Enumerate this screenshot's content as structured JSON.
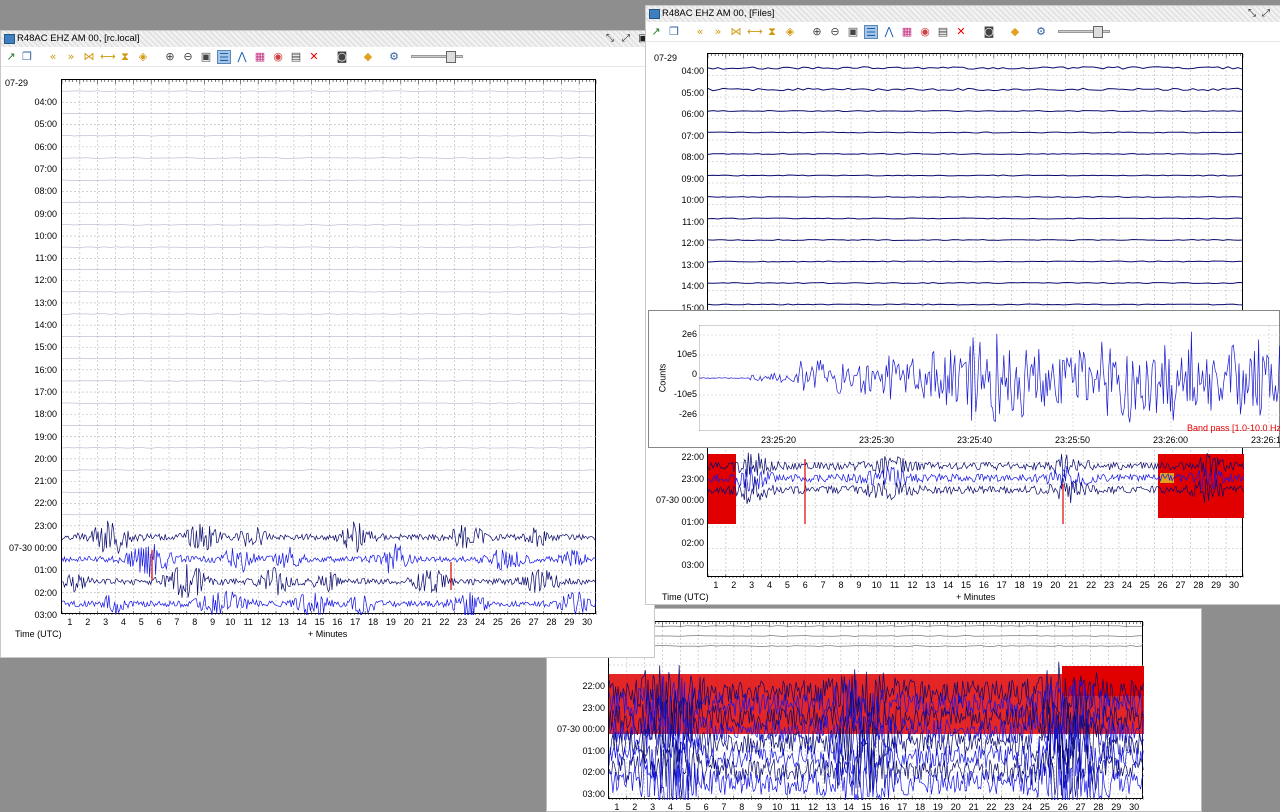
{
  "left_window": {
    "title": "R48AC EHZ AM 00, [rc.local]",
    "date_label": "07-29",
    "hours": [
      "04:00",
      "05:00",
      "06:00",
      "07:00",
      "08:00",
      "09:00",
      "10:00",
      "11:00",
      "12:00",
      "13:00",
      "14:00",
      "15:00",
      "16:00",
      "17:00",
      "18:00",
      "19:00",
      "20:00",
      "21:00",
      "22:00",
      "23:00",
      "07-30 00:00",
      "01:00",
      "02:00",
      "03:00"
    ],
    "minutes": [
      "1",
      "2",
      "3",
      "4",
      "5",
      "6",
      "7",
      "8",
      "9",
      "10",
      "11",
      "12",
      "13",
      "14",
      "15",
      "16",
      "17",
      "18",
      "19",
      "20",
      "21",
      "22",
      "23",
      "24",
      "25",
      "26",
      "27",
      "28",
      "29",
      "30"
    ],
    "time_axis_label": "Time (UTC)",
    "minutes_axis_label": "+ Minutes"
  },
  "right_window": {
    "title": "R48AC EHZ AM 00, [Files]",
    "date_label": "07-29",
    "top_hours": [
      "04:00",
      "05:00",
      "06:00",
      "07:00",
      "08:00",
      "09:00",
      "10:00",
      "11:00",
      "12:00",
      "13:00",
      "14:00",
      "15:00"
    ],
    "bottom_hours": [
      "22:00",
      "23:00",
      "07-30 00:00",
      "01:00",
      "02:00",
      "03:00"
    ],
    "minutes": [
      "1",
      "2",
      "3",
      "4",
      "5",
      "6",
      "7",
      "8",
      "9",
      "10",
      "11",
      "12",
      "13",
      "14",
      "15",
      "16",
      "17",
      "18",
      "19",
      "20",
      "21",
      "22",
      "23",
      "24",
      "25",
      "26",
      "27",
      "28",
      "29",
      "30"
    ],
    "time_axis_label": "Time (UTC)",
    "minutes_axis_label": "+ Minutes",
    "waveform": {
      "ylabel": "Counts",
      "yticks": [
        "2e6",
        "10e5",
        "0",
        "-10e5",
        "-2e6"
      ],
      "xticks": [
        "23:25:20",
        "23:25:30",
        "23:25:40",
        "23:25:50",
        "23:26:00",
        "23:26:1"
      ],
      "filter_label": "Band pass [1.0-10.0 Hz"
    }
  },
  "bottom_window": {
    "hours": [
      "22:00",
      "23:00",
      "07-30 00:00",
      "01:00",
      "02:00",
      "03:00"
    ],
    "minutes": [
      "1",
      "2",
      "3",
      "4",
      "5",
      "6",
      "7",
      "8",
      "9",
      "10",
      "11",
      "12",
      "13",
      "14",
      "15",
      "16",
      "17",
      "18",
      "19",
      "20",
      "21",
      "22",
      "23",
      "24",
      "25",
      "26",
      "27",
      "28",
      "29",
      "30"
    ]
  },
  "toolbar": {
    "buttons": [
      "export-icon",
      "copy-icon",
      "rewind-icon",
      "forward-icon",
      "shrink-icon",
      "expand-icon",
      "hourglass-icon",
      "filter-icon",
      "zoom-in-icon",
      "zoom-out-icon",
      "zoom-fit-icon",
      "helicorder-icon",
      "spectrum-icon",
      "spectrogram-icon",
      "palette-icon",
      "trash-icon",
      "close-icon",
      "camera-icon",
      "tag-icon",
      "settings-icon"
    ]
  },
  "colors": {
    "trace_dark": "#0a0a6e",
    "trace_blue": "#1515e8",
    "trace_red": "#e00000",
    "grid": "#b8b8b8",
    "desktop": "#8e8e8e"
  }
}
